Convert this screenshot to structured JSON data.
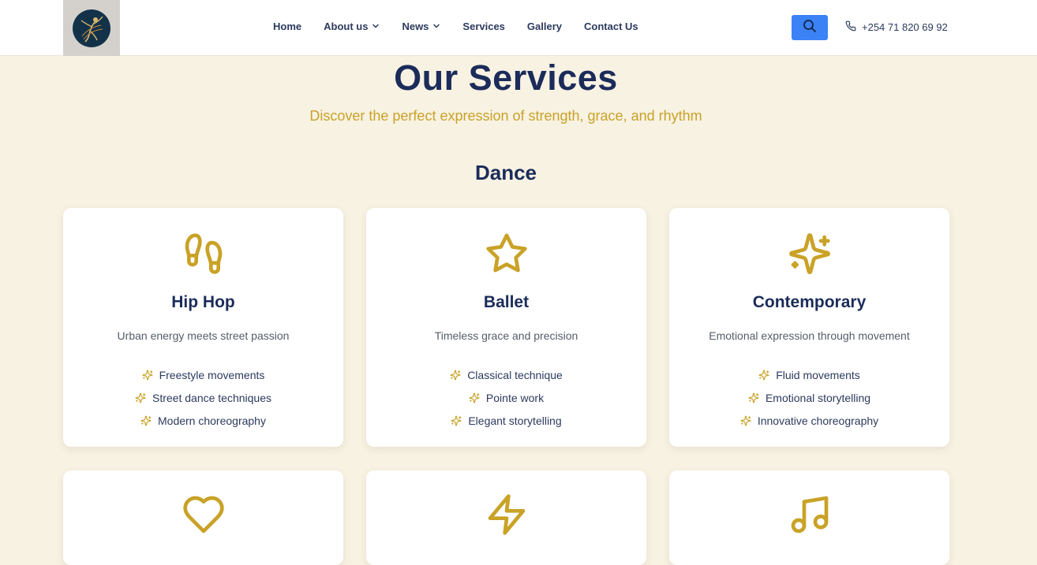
{
  "header": {
    "nav": [
      {
        "label": "Home",
        "dropdown": false
      },
      {
        "label": "About us",
        "dropdown": true
      },
      {
        "label": "News",
        "dropdown": true
      },
      {
        "label": "Services",
        "dropdown": false
      },
      {
        "label": "Gallery",
        "dropdown": false
      },
      {
        "label": "Contact Us",
        "dropdown": false
      }
    ],
    "phone": "+254 71 820 69 92",
    "search_icon": "search-icon",
    "accent_color": "#3b82f6"
  },
  "hero": {
    "title": "Our Services",
    "subtitle": "Discover the perfect expression of strength, grace, and rhythm"
  },
  "section": {
    "title": "Dance"
  },
  "cards": [
    {
      "icon": "footprints-icon",
      "title": "Hip Hop",
      "description": "Urban energy meets street passion",
      "features": [
        "Freestyle movements",
        "Street dance techniques",
        "Modern choreography"
      ]
    },
    {
      "icon": "star-icon",
      "title": "Ballet",
      "description": "Timeless grace and precision",
      "features": [
        "Classical technique",
        "Pointe work",
        "Elegant storytelling"
      ]
    },
    {
      "icon": "sparkles-icon",
      "title": "Contemporary",
      "description": "Emotional expression through movement",
      "features": [
        "Fluid movements",
        "Emotional storytelling",
        "Innovative choreography"
      ]
    }
  ],
  "cards_row2_icons": [
    "heart-icon",
    "zap-icon",
    "music-icon"
  ],
  "colors": {
    "background": "#f8f2e3",
    "navy": "#1b2c5a",
    "gold": "#c9a227"
  }
}
